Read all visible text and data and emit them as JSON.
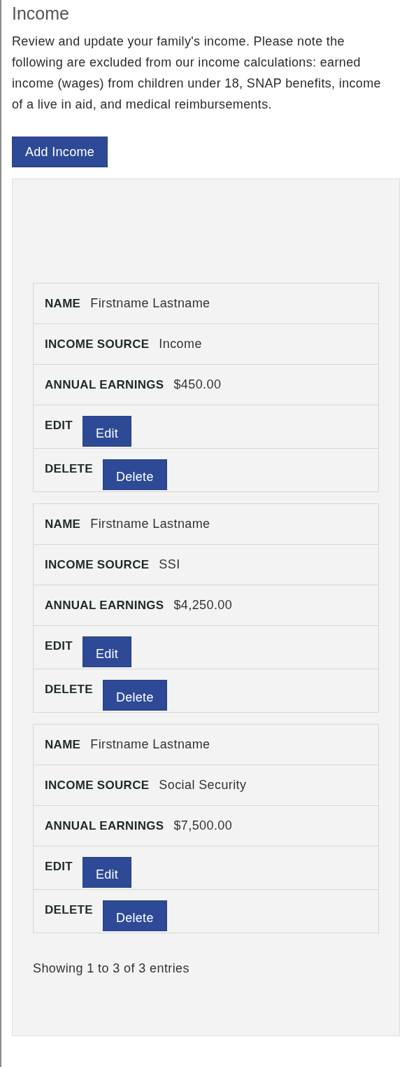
{
  "title": "Income",
  "intro": "Review and update your family's income. Please note the following are excluded from our income calculations: earned income (wages) from children under 18, SNAP benefits, income of a live in aid, and medical reimbursements.",
  "add_button": "Add Income",
  "records": [
    {
      "name": {
        "label": "NAME",
        "value": "Firstname Lastname"
      },
      "income_source": {
        "label": "INCOME SOURCE",
        "value": "Income"
      },
      "annual_earnings": {
        "label": "ANNUAL EARNINGS",
        "value": "$450.00"
      },
      "edit": {
        "label": "EDIT",
        "button": "Edit"
      },
      "delete": {
        "label": "DELETE",
        "button": "Delete"
      }
    },
    {
      "name": {
        "label": "NAME",
        "value": "Firstname Lastname"
      },
      "income_source": {
        "label": "INCOME SOURCE",
        "value": "SSI"
      },
      "annual_earnings": {
        "label": "ANNUAL EARNINGS",
        "value": "$4,250.00"
      },
      "edit": {
        "label": "EDIT",
        "button": "Edit"
      },
      "delete": {
        "label": "DELETE",
        "button": "Delete"
      }
    },
    {
      "name": {
        "label": "NAME",
        "value": "Firstname Lastname"
      },
      "income_source": {
        "label": "INCOME SOURCE",
        "value": "Social Security"
      },
      "annual_earnings": {
        "label": "ANNUAL EARNINGS",
        "value": "$7,500.00"
      },
      "edit": {
        "label": "EDIT",
        "button": "Edit"
      },
      "delete": {
        "label": "DELETE",
        "button": "Delete"
      }
    }
  ],
  "info": "Showing 1 to 3 of 3 entries"
}
